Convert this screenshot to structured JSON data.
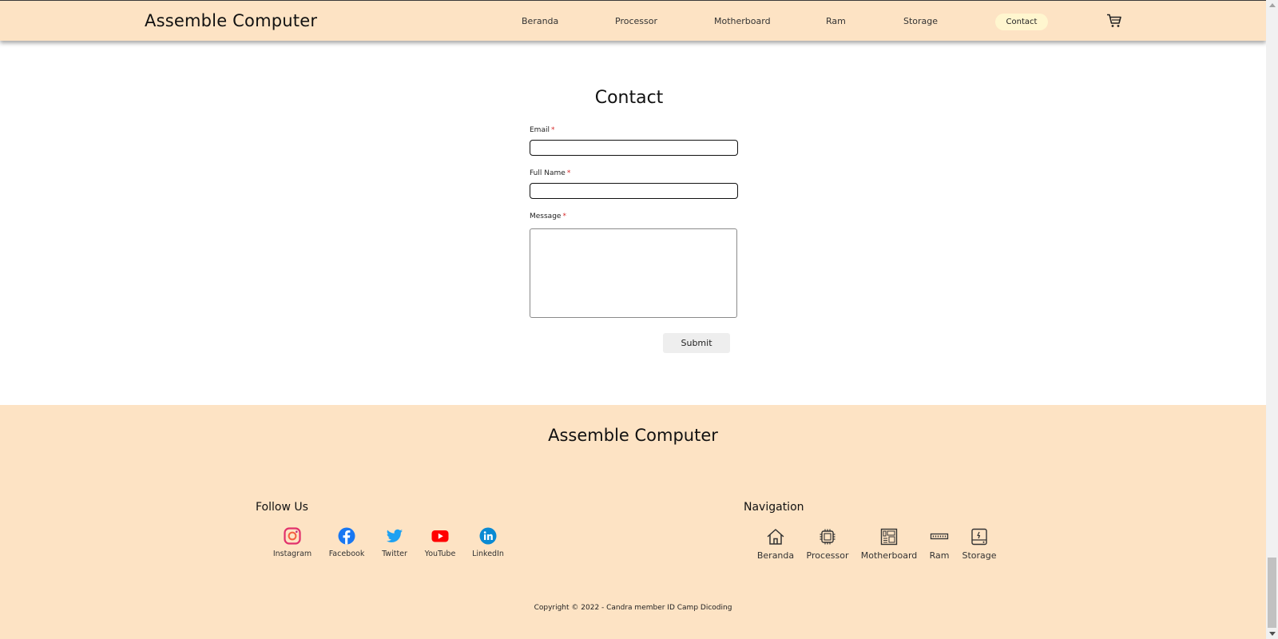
{
  "header": {
    "brand": "Assemble Computer",
    "nav": [
      "Beranda",
      "Processor",
      "Motherboard",
      "Ram",
      "Storage"
    ],
    "active": "Contact",
    "cart_icon": "cart-icon"
  },
  "contact": {
    "title": "Contact",
    "fields": {
      "email": {
        "label": "Email",
        "required_mark": "*",
        "value": ""
      },
      "full_name": {
        "label": "Full Name",
        "required_mark": "*",
        "value": ""
      },
      "message": {
        "label": "Message",
        "required_mark": "*",
        "value": ""
      }
    },
    "submit_label": "Submit"
  },
  "footer": {
    "brand": "Assemble Computer",
    "follow_heading": "Follow Us",
    "social": [
      {
        "label": "Instagram",
        "icon": "instagram-icon"
      },
      {
        "label": "Facebook",
        "icon": "facebook-icon"
      },
      {
        "label": "Twitter",
        "icon": "twitter-icon"
      },
      {
        "label": "YouTube",
        "icon": "youtube-icon"
      },
      {
        "label": "LinkedIn",
        "icon": "linkedin-icon"
      }
    ],
    "nav_heading": "Navigation",
    "nav_links": [
      {
        "label": "Beranda",
        "icon": "home-icon"
      },
      {
        "label": "Processor",
        "icon": "cpu-icon"
      },
      {
        "label": "Motherboard",
        "icon": "motherboard-icon"
      },
      {
        "label": "Ram",
        "icon": "ram-icon"
      },
      {
        "label": "Storage",
        "icon": "storage-icon"
      }
    ],
    "copyright": "Copyright © 2022 - Candra member ID Camp Dicoding"
  },
  "colors": {
    "header_bg": "#fde3c4",
    "active_pill": "#fff6cf",
    "required": "#d62828"
  }
}
